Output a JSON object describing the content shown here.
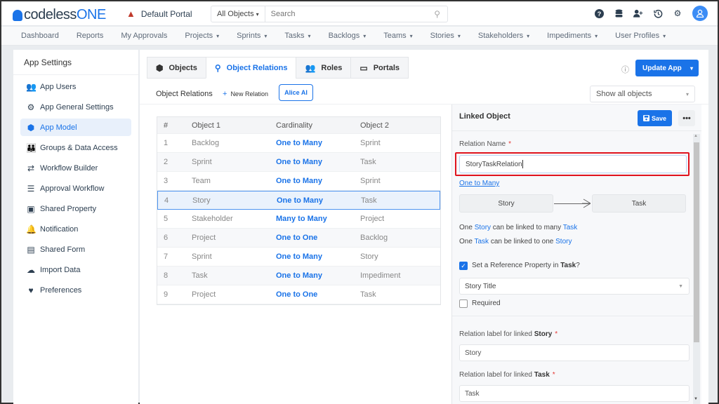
{
  "header": {
    "logo_part1": "codeless",
    "logo_part2": "ONE",
    "portal_name": "Default Portal",
    "search_scope": "All Objects",
    "search_placeholder": "Search",
    "icons": [
      "help-icon",
      "database-icon",
      "add-user-icon",
      "history-icon",
      "gear-icon",
      "avatar"
    ]
  },
  "nav": {
    "items": [
      {
        "label": "Dashboard",
        "dropdown": false
      },
      {
        "label": "Reports",
        "dropdown": false
      },
      {
        "label": "My Approvals",
        "dropdown": false
      },
      {
        "label": "Projects",
        "dropdown": true
      },
      {
        "label": "Sprints",
        "dropdown": true
      },
      {
        "label": "Tasks",
        "dropdown": true
      },
      {
        "label": "Backlogs",
        "dropdown": true
      },
      {
        "label": "Teams",
        "dropdown": true
      },
      {
        "label": "Stories",
        "dropdown": true
      },
      {
        "label": "Stakeholders",
        "dropdown": true
      },
      {
        "label": "Impediments",
        "dropdown": true
      },
      {
        "label": "User Profiles",
        "dropdown": true
      }
    ],
    "caret": "▾"
  },
  "sidebar": {
    "title": "App Settings",
    "items": [
      {
        "label": "App Users",
        "icon": "users-icon",
        "glyph": "👥",
        "active": false
      },
      {
        "label": "App General Settings",
        "icon": "gear-icon",
        "glyph": "⚙",
        "active": false
      },
      {
        "label": "App Model",
        "icon": "cube-icon",
        "glyph": "⬢",
        "active": true
      },
      {
        "label": "Groups & Data Access",
        "icon": "group-icon",
        "glyph": "👪",
        "active": false
      },
      {
        "label": "Workflow Builder",
        "icon": "exchange-icon",
        "glyph": "⇄",
        "active": false
      },
      {
        "label": "Approval Workflow",
        "icon": "checklist-icon",
        "glyph": "☰",
        "active": false
      },
      {
        "label": "Shared Property",
        "icon": "inbox-icon",
        "glyph": "▣",
        "active": false
      },
      {
        "label": "Notification",
        "icon": "bell-icon",
        "glyph": "🔔",
        "active": false
      },
      {
        "label": "Shared Form",
        "icon": "form-icon",
        "glyph": "▤",
        "active": false
      },
      {
        "label": "Import Data",
        "icon": "cloud-upload-icon",
        "glyph": "☁",
        "active": false
      },
      {
        "label": "Preferences",
        "icon": "preferences-icon",
        "glyph": "♥",
        "active": false
      }
    ]
  },
  "tabs": [
    {
      "label": "Objects",
      "icon": "cube-icon",
      "glyph": "⬢",
      "active": false
    },
    {
      "label": "Object Relations",
      "icon": "relations-icon",
      "glyph": "⚲",
      "active": true
    },
    {
      "label": "Roles",
      "icon": "roles-icon",
      "glyph": "👥",
      "active": false
    },
    {
      "label": "Portals",
      "icon": "monitor-icon",
      "glyph": "▭",
      "active": false
    }
  ],
  "toolbar": {
    "update_label": "Update App",
    "section_title": "Object Relations",
    "new_relation_label": "New Relation",
    "alice_label": "Alice AI",
    "filter_value": "Show all objects"
  },
  "table": {
    "headers": [
      "#",
      "Object 1",
      "Cardinality",
      "Object 2"
    ],
    "rows": [
      {
        "num": "1",
        "obj1": "Backlog",
        "card": "One to Many",
        "obj2": "Sprint"
      },
      {
        "num": "2",
        "obj1": "Sprint",
        "card": "One to Many",
        "obj2": "Task"
      },
      {
        "num": "3",
        "obj1": "Team",
        "card": "One to Many",
        "obj2": "Sprint"
      },
      {
        "num": "4",
        "obj1": "Story",
        "card": "One to Many",
        "obj2": "Task"
      },
      {
        "num": "5",
        "obj1": "Stakeholder",
        "card": "Many to Many",
        "obj2": "Project"
      },
      {
        "num": "6",
        "obj1": "Project",
        "card": "One to One",
        "obj2": "Backlog"
      },
      {
        "num": "7",
        "obj1": "Sprint",
        "card": "One to Many",
        "obj2": "Story"
      },
      {
        "num": "8",
        "obj1": "Task",
        "card": "One to Many",
        "obj2": "Impediment"
      },
      {
        "num": "9",
        "obj1": "Project",
        "card": "One to One",
        "obj2": "Task"
      }
    ],
    "selected_row": 4
  },
  "panel": {
    "title": "Linked Object",
    "save_label": "Save",
    "more_label": "•••",
    "relation_name_label": "Relation Name",
    "required_mark": "*",
    "relation_name_value": "StoryTaskRelation",
    "cardinality_link": "One to Many",
    "object1": "Story",
    "object2": "Task",
    "sentence1": {
      "p1": "One ",
      "o1": "Story",
      "p2": " can be linked to many ",
      "o2": "Task"
    },
    "sentence2": {
      "p1": "One ",
      "o1": "Task",
      "p2": " can be linked to one ",
      "o2": "Story"
    },
    "ref_checkbox": {
      "checked": true,
      "text": "Set a Reference Property in ",
      "bold": "Task",
      "suffix": "?"
    },
    "ref_property_value": "Story Title",
    "required_checkbox": {
      "checked": false,
      "label": "Required"
    },
    "label1": {
      "text": "Relation label for linked ",
      "bold": "Story",
      "value": "Story"
    },
    "label2": {
      "text": "Relation label for linked ",
      "bold": "Task",
      "value": "Task"
    }
  }
}
